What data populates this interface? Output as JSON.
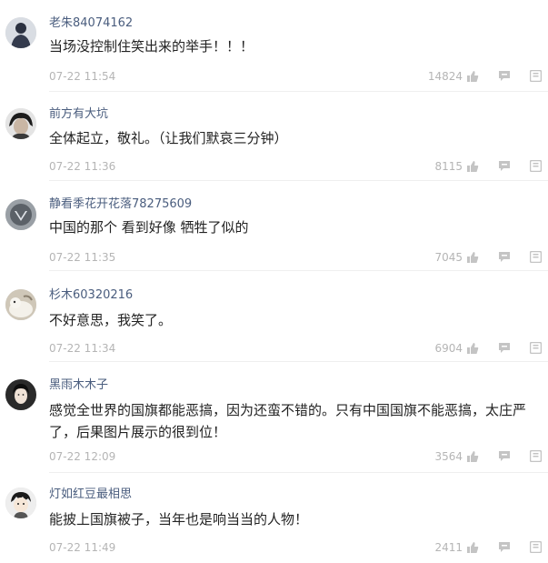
{
  "comments": [
    {
      "user": "老朱84074162",
      "text": "当场没控制住笑出来的举手！！！",
      "time": "07-22 11:54",
      "likes": "14824",
      "avatar": "avatar-dark-figure"
    },
    {
      "user": "前方有大坑",
      "text": "全体起立，敬礼。（让我们默哀三分钟）",
      "time": "07-22 11:36",
      "likes": "8115",
      "avatar": "avatar-person-dark-hair"
    },
    {
      "user": "静看季花开花落78275609",
      "text": "中国的那个 看到好像 牺牲了似的",
      "time": "07-22 11:35",
      "likes": "7045",
      "avatar": "avatar-gray-emblem"
    },
    {
      "user": "杉木60320216",
      "text": "不好意思，我笑了。",
      "time": "07-22 11:34",
      "likes": "6904",
      "avatar": "avatar-white-pet"
    },
    {
      "user": "黑雨木木子",
      "text": "感觉全世界的国旗都能恶搞，因为还蛮不错的。只有中国国旗不能恶搞，太庄严了，后果图片展示的很到位！",
      "time": "07-22 12:09",
      "likes": "3564",
      "avatar": "avatar-woman-portrait"
    },
    {
      "user": "灯如红豆最相思",
      "text": "能披上国旗被子，当年也是响当当的人物！",
      "time": "07-22 11:49",
      "likes": "2411",
      "avatar": "avatar-cartoon-boy"
    }
  ],
  "icons": {
    "like": "thumbs-up-icon",
    "reply": "reply-bubble-icon",
    "more": "more-square-icon"
  },
  "colors": {
    "username": "#4a5d7e",
    "meta": "#b5b5b5",
    "text": "#222222"
  }
}
